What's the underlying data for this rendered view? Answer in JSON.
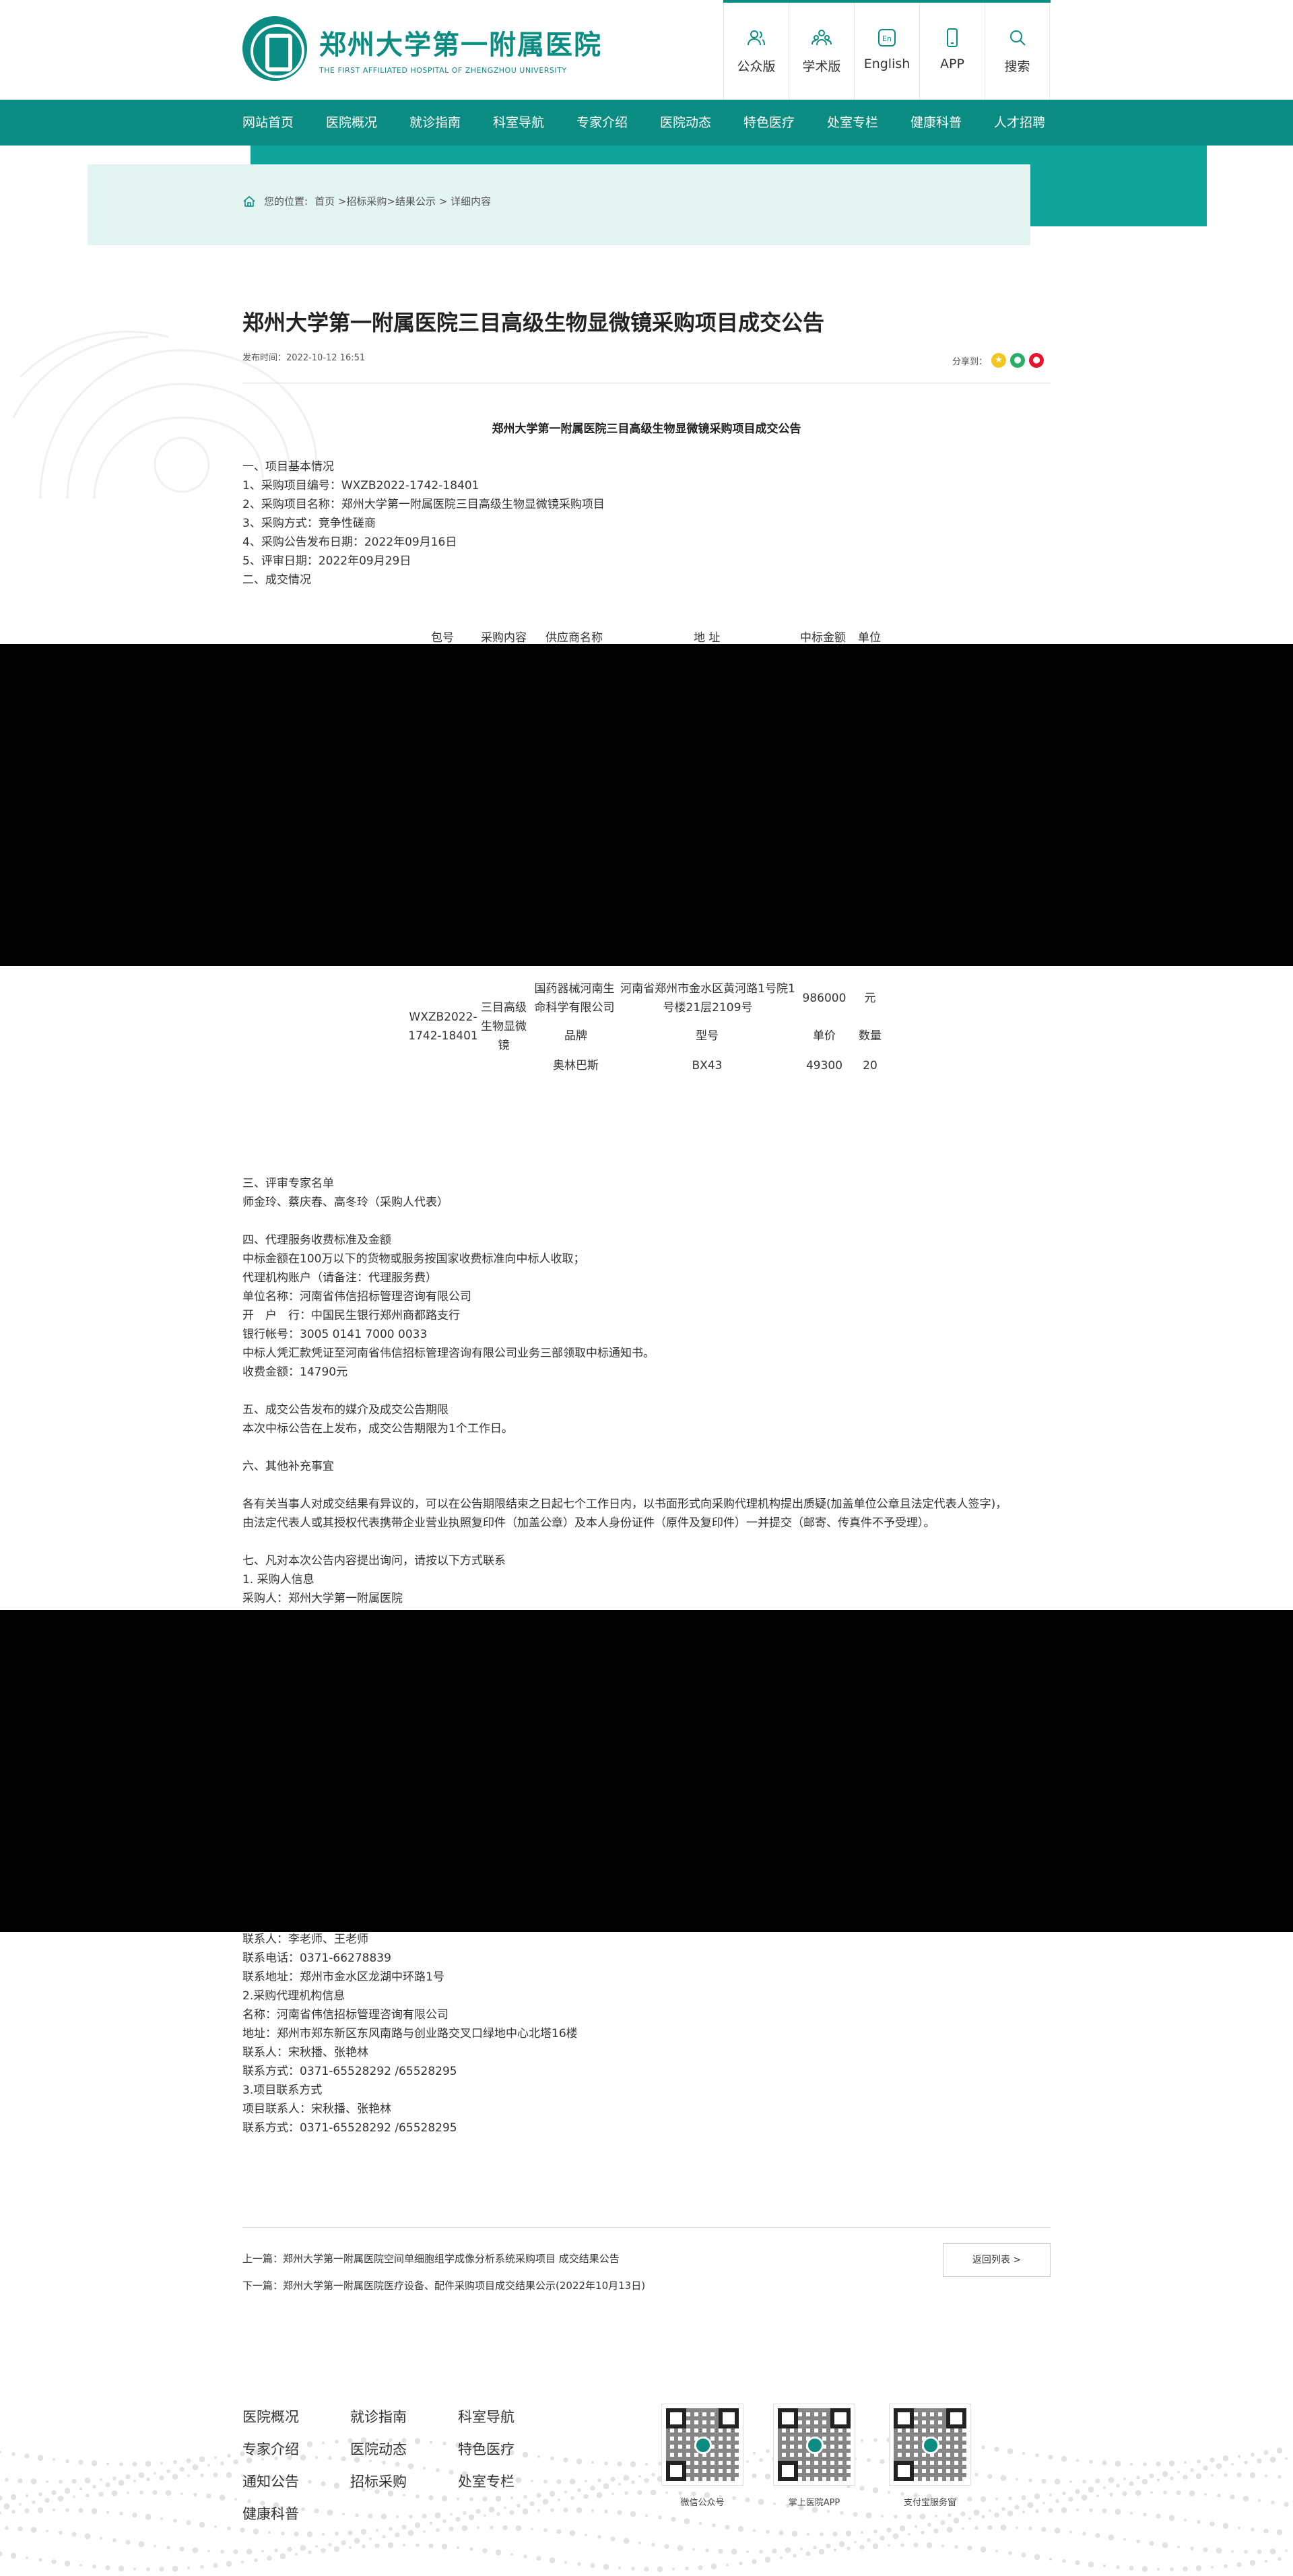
{
  "header": {
    "logo_cn": "郑州大学第一附属医院",
    "logo_en": "THE FIRST AFFILIATED HOSPITAL OF ZHENGZHOU UNIVERSITY",
    "buttons": [
      {
        "label": "公众版",
        "icon": "public-users-icon"
      },
      {
        "label": "学术版",
        "icon": "academic-group-icon"
      },
      {
        "label": "English",
        "icon": "english-icon"
      },
      {
        "label": "APP",
        "icon": "mobile-phone-icon"
      },
      {
        "label": "搜索",
        "icon": "search-icon"
      }
    ]
  },
  "nav": {
    "items": [
      "网站首页",
      "医院概况",
      "就诊指南",
      "科室导航",
      "专家介绍",
      "医院动态",
      "特色医疗",
      "处室专栏",
      "健康科普",
      "人才招聘"
    ]
  },
  "breadcrumb": {
    "prefix": "您的位置:",
    "path": "首页 >招标采购>结果公示 > 详细内容"
  },
  "article": {
    "title": "郑州大学第一附属医院三目高级生物显微镜采购项目成交公告",
    "publish_time": "发布时间：2022-10-12 16:51",
    "share_label": "分享到：",
    "heading": "郑州大学第一附属医院三目高级生物显微镜采购项目成交公告",
    "lines_basic": [
      "一、项目基本情况",
      "1、采购项目编号：WXZB2022-1742-18401",
      "2、采购项目名称：郑州大学第一附属医院三目高级生物显微镜采购项目",
      "3、采购方式：竞争性磋商",
      "4、采购公告发布日期：2022年09月16日",
      "5、评审日期：2022年09月29日"
    ],
    "section2": "二、成交情况",
    "table": {
      "headers": [
        "包号",
        "采购内容",
        "供应商名称",
        "地 址",
        "中标金额",
        "单位"
      ],
      "package": "WXZB2022-1742-18401",
      "content": "三目高级生物显微镜",
      "supplier": "国药器械河南生命科学有限公司",
      "address": "河南省郑州市金水区黄河路1号院1号楼21层2109号",
      "amount": "986000",
      "unit": "元",
      "sub_headers": [
        "品牌",
        "型号",
        "单价",
        "数量"
      ],
      "sub_row": [
        "奥林巴斯",
        "BX43",
        "49300",
        "20"
      ]
    },
    "lines_later": [
      "三、评审专家名单",
      "师金玲、蔡庆春、高冬玲（采购人代表）",
      "",
      "四、代理服务收费标准及金额",
      "中标金额在100万以下的货物或服务按国家收费标准向中标人收取；",
      "代理机构账户（请备注：代理服务费）",
      "单位名称：河南省伟信招标管理咨询有限公司",
      "开　户　行：中国民生银行郑州商都路支行",
      "银行帐号：3005 0141 7000 0033",
      "中标人凭汇款凭证至河南省伟信招标管理咨询有限公司业务三部领取中标通知书。",
      "收费金额：14790元",
      "",
      "五、成交公告发布的媒介及成交公告期限",
      "本次中标公告在上发布，成交公告期限为1个工作日。",
      "",
      "六、其他补充事宜",
      "",
      "各有关当事人对成交结果有异议的，可以在公告期限结束之日起七个工作日内，以书面形式向采购代理机构提出质疑(加盖单位公章且法定代表人签字)，",
      "由法定代表人或其授权代表携带企业营业执照复印件（加盖公章）及本人身份证件（原件及复印件）一并提交（邮寄、传真件不予受理）。",
      "",
      "七、凡对本次公告内容提出询问，请按以下方式联系",
      "1. 采购人信息",
      "采购人：郑州大学第一附属医院"
    ],
    "lines_contact": [
      "联系人：李老师、王老师",
      "联系电话：0371-66278839",
      "联系地址：郑州市金水区龙湖中环路1号",
      "2.采购代理机构信息",
      "名称：河南省伟信招标管理咨询有限公司",
      "地址：郑州市郑东新区东风南路与创业路交叉口绿地中心北塔16楼",
      "联系人：宋秋播、张艳林",
      "联系方式：0371-65528292 /65528295",
      "3.项目联系方式",
      "项目联系人：宋秋播、张艳林",
      "联系方式：0371-65528292 /65528295"
    ]
  },
  "pager": {
    "prev_label": "上一篇：",
    "prev_title": "郑州大学第一附属医院空间单细胞组学成像分析系统采购项目 成交结果公告",
    "next_label": "下一篇：",
    "next_title": "郑州大学第一附属医院医疗设备、配件采购项目成交结果公示(2022年10月13日)",
    "back_button": "返回列表 >"
  },
  "footer": {
    "links": [
      "医院概况",
      "就诊指南",
      "科室导航",
      "专家介绍",
      "医院动态",
      "特色医疗",
      "通知公告",
      "招标采购",
      "处室专栏",
      "健康科普"
    ],
    "qr_labels": [
      "微信公众号",
      "掌上医院APP",
      "支付宝服务窗"
    ]
  },
  "colors": {
    "brand": "#0b8c82",
    "brand_light": "#0fa59a",
    "crumb_bg": "#e3f4f2"
  }
}
